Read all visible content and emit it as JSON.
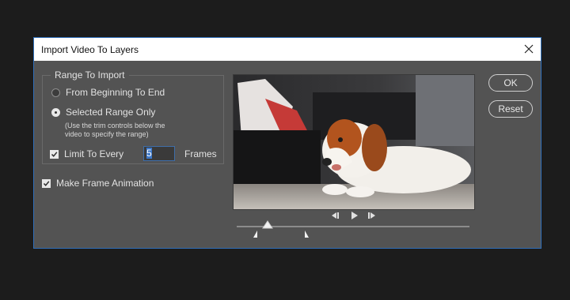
{
  "dialog": {
    "title": "Import Video To Layers",
    "icon_close": "close-icon"
  },
  "range": {
    "legend": "Range To Import",
    "options": [
      {
        "label": "From Beginning To End",
        "selected": false
      },
      {
        "label": "Selected Range Only",
        "selected": true
      }
    ],
    "hint_line1": "(Use the trim controls below the",
    "hint_line2": "video to specify the range)",
    "limit_label": "Limit To Every",
    "limit_checked": true,
    "limit_value": "5",
    "frames_label": "Frames"
  },
  "make_animation": {
    "label": "Make Frame Animation",
    "checked": true
  },
  "buttons": {
    "ok": "OK",
    "reset": "Reset"
  },
  "player": {
    "icons": [
      "step-back-icon",
      "play-icon",
      "step-forward-icon"
    ],
    "playhead_position": 0.13,
    "trim_start": 0.08,
    "trim_end": 0.3
  },
  "colors": {
    "accent": "#2f6fba",
    "dialog_bg": "#535353",
    "page_bg": "#1c1c1c"
  }
}
